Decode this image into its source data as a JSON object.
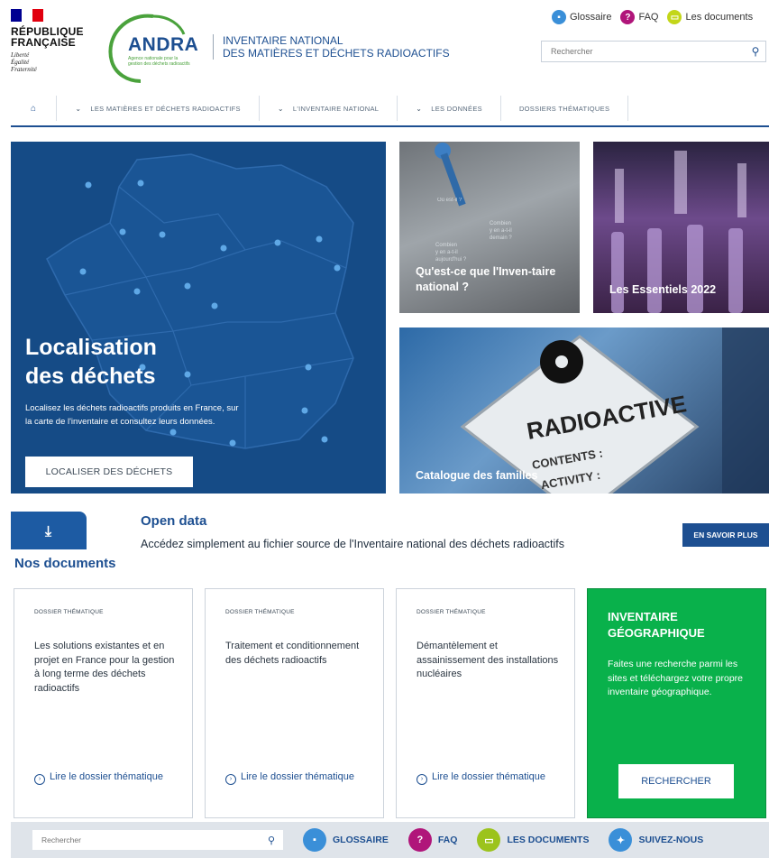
{
  "header": {
    "rf_line1": "RÉPUBLIQUE",
    "rf_line2": "FRANÇAISE",
    "devise1": "Liberté",
    "devise2": "Égalité",
    "devise3": "Fraternité",
    "andra": "ANDRA",
    "andra_sub": "Agence nationale pour la gestion des déchets radioactifs",
    "site_title_line1": "INVENTAIRE NATIONAL",
    "site_title_line2": "DES MATIÈRES ET DÉCHETS RADIOACTIFS",
    "links": {
      "glossaire": "Glossaire",
      "faq": "FAQ",
      "documents": "Les documents"
    },
    "search_placeholder": "Rechercher"
  },
  "nav": {
    "items": [
      "LES MATIÈRES ET DÉCHETS RADIOACTIFS",
      "L'INVENTAIRE NATIONAL",
      "LES DONNÉES",
      "DOSSIERS THÉMATIQUES"
    ]
  },
  "hero": {
    "title_line1": "Localisation",
    "title_line2": "des déchets",
    "text": "Localisez les déchets radioactifs produits en France, sur la carte de l'inventaire et consultez leurs données.",
    "button": "LOCALISER DES DÉCHETS"
  },
  "tiles": {
    "question": "Qu'est-ce que l'Inven-taire national ?",
    "essentiels": "Les Essentiels 2022",
    "catalogue": "Catalogue des familles",
    "radio_label": "RADIOACTIVE",
    "contents_label": "CONTENTS :",
    "activity_label": "ACTIVITY :"
  },
  "opendata": {
    "title": "Open data",
    "text": "Accédez simplement au fichier source de l'Inventaire national des déchets radioactifs",
    "button": "EN SAVOIR PLUS"
  },
  "docs": {
    "title": "Nos documents",
    "cards": [
      {
        "tag": "DOSSIER THÉMATIQUE",
        "text": "Les solutions existantes et en projet en France pour la gestion à long terme des déchets radioactifs",
        "link": "Lire le dossier thématique"
      },
      {
        "tag": "DOSSIER THÉMATIQUE",
        "text": "Traitement et conditionnement des déchets radioactifs",
        "link": "Lire le dossier thématique"
      },
      {
        "tag": "DOSSIER THÉMATIQUE",
        "text": "Démantèlement et assainissement des installations nucléaires",
        "link": "Lire le dossier thématique"
      }
    ],
    "geo": {
      "title": "INVENTAIRE GÉOGRAPHIQUE",
      "text": "Faites une recherche parmi les sites et téléchargez votre propre inventaire géographique.",
      "button": "RECHERCHER"
    }
  },
  "footer": {
    "search_placeholder": "Rechercher",
    "glossaire": "GLOSSAIRE",
    "faq": "FAQ",
    "documents": "LES DOCUMENTS",
    "suivez": "SUIVEZ-NOUS"
  },
  "colors": {
    "brand_blue": "#1d4f91",
    "hero_blue": "#154b86",
    "green": "#09b14b",
    "faq_purple": "#b0157a",
    "docs_lime": "#9cc31c",
    "glossaire_blue": "#3a8fd8"
  }
}
